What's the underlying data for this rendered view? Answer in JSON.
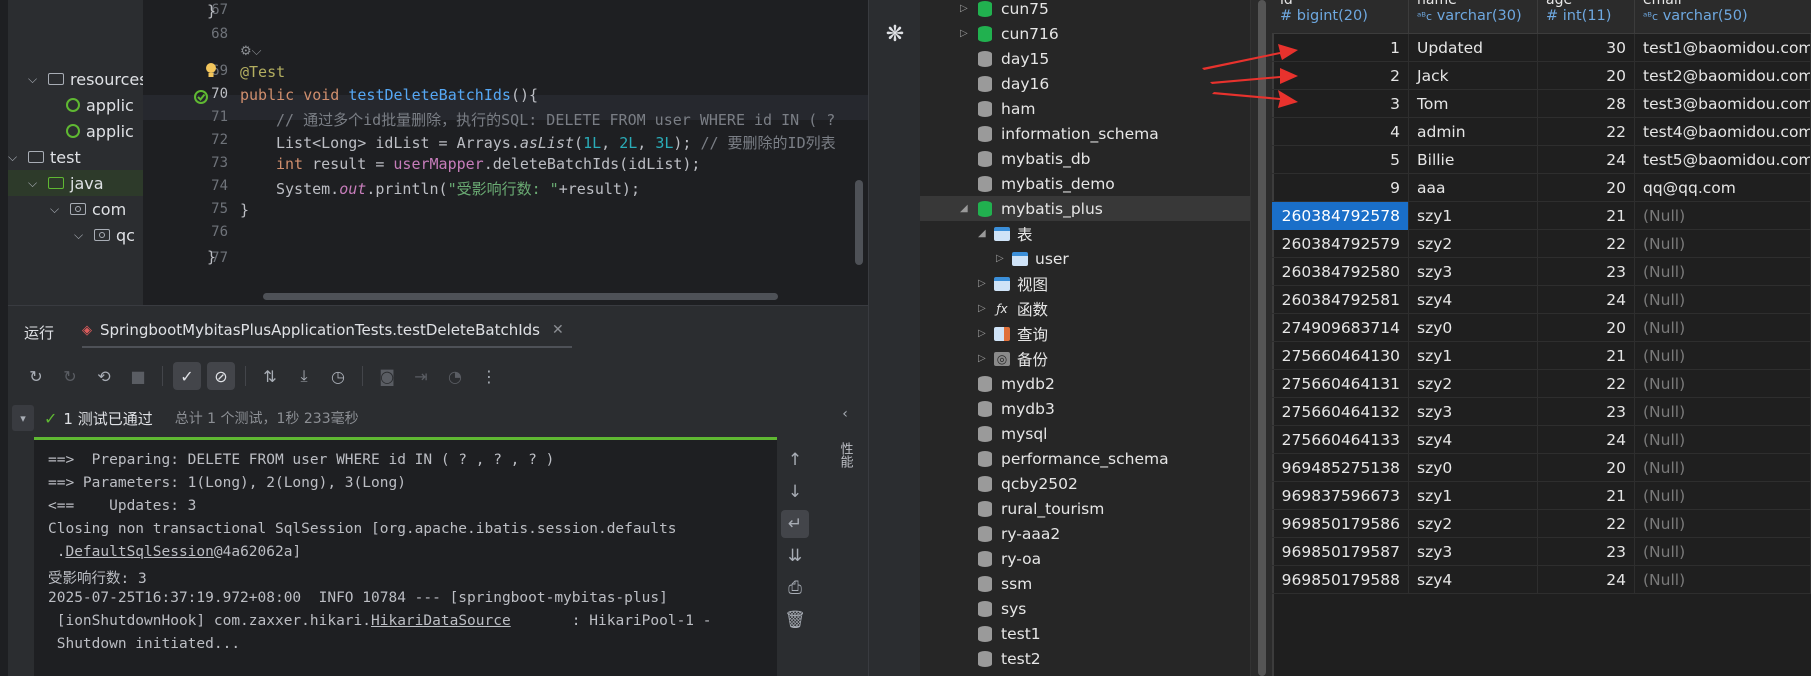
{
  "project_tree": {
    "items": [
      {
        "label": "resources"
      },
      {
        "label": "applic"
      },
      {
        "label": "applic"
      },
      {
        "label": "test"
      },
      {
        "label": "java"
      },
      {
        "label": "com"
      },
      {
        "label": "qc"
      }
    ]
  },
  "editor": {
    "line_numbers": [
      "67",
      "68",
      "69",
      "70",
      "71",
      "72",
      "73",
      "74",
      "75",
      "76",
      "77"
    ],
    "lines": {
      "l67": "}",
      "l69_annotation": "@Test",
      "l70_kw1": "public",
      "l70_kw2": "void",
      "l70_fn": "testDeleteBatchIds",
      "l70_rest": "(){",
      "l71_comment": "// 通过多个id批量删除，执行的SQL: DELETE FROM user WHERE id IN ( ?",
      "l72_a": "List<Long> idList = Arrays.",
      "l72_fn": "asList",
      "l72_b": "(",
      "l72_n1": "1L",
      "l72_c": ", ",
      "l72_n2": "2L",
      "l72_d": ", ",
      "l72_n3": "3L",
      "l72_e": "); ",
      "l72_comment": "// 要删除的ID列表",
      "l73_kw": "int",
      "l73_a": " result = ",
      "l73_fld": "userMapper",
      "l73_b": ".deleteBatchIds(idList);",
      "l74_a": "System.",
      "l74_out": "out",
      "l74_b": ".println(",
      "l74_str": "\"受影响行数: \"",
      "l74_c": "+result);",
      "l75": "}",
      "l77": "}"
    }
  },
  "run_panel": {
    "title": "运行",
    "tab_label": "SpringbootMybitasPlusApplicationTests.testDeleteBatchIds",
    "status_text": "1 测试已通过",
    "status_detail": "总计 1 个测试，1秒 233毫秒",
    "console_lines": {
      "c1": "==>  Preparing: DELETE FROM user WHERE id IN ( ? , ? , ? )",
      "c2": "==> Parameters: 1(Long), 2(Long), 3(Long)",
      "c3": "<==    Updates: 3",
      "c4": "Closing non transactional SqlSession [org.apache.ibatis.session.defaults",
      "c5a": " .",
      "c5b": "DefaultSqlSession",
      "c5c": "@4a62062a]",
      "c6": "受影响行数: 3",
      "c7": "2025-07-25T16:37:19.972+08:00  INFO 10784 --- [springboot-mybitas-plus]",
      "c8a": " [ionShutdownHook] com.zaxxer.hikari.",
      "c8b": "HikariDataSource",
      "c8c": "       : HikariPool-1 -",
      "c9": " Shutdown initiated..."
    },
    "perf_label": "性能"
  },
  "db_tree": {
    "items": [
      {
        "label": "cun75"
      },
      {
        "label": "cun716"
      },
      {
        "label": "day15"
      },
      {
        "label": "day16"
      },
      {
        "label": "ham"
      },
      {
        "label": "information_schema"
      },
      {
        "label": "mybatis_db"
      },
      {
        "label": "mybatis_demo"
      },
      {
        "label": "mybatis_plus"
      },
      {
        "label": "表"
      },
      {
        "label": "user"
      },
      {
        "label": "视图"
      },
      {
        "label": "函数"
      },
      {
        "label": "查询"
      },
      {
        "label": "备份"
      },
      {
        "label": "mydb2"
      },
      {
        "label": "mydb3"
      },
      {
        "label": "mysql"
      },
      {
        "label": "performance_schema"
      },
      {
        "label": "qcby2502"
      },
      {
        "label": "rural_tourism"
      },
      {
        "label": "ry-aaa2"
      },
      {
        "label": "ry-oa"
      },
      {
        "label": "ssm"
      },
      {
        "label": "sys"
      },
      {
        "label": "test1"
      },
      {
        "label": "test2"
      }
    ]
  },
  "grid": {
    "columns": [
      {
        "name": "id",
        "type": "bigint(20)"
      },
      {
        "name": "name",
        "type": "varchar(30)"
      },
      {
        "name": "age",
        "type": "int(11)"
      },
      {
        "name": "email",
        "type": "varchar(50)"
      }
    ],
    "rows": [
      [
        "1",
        "Updated",
        "30",
        "test1@baomidou.com"
      ],
      [
        "2",
        "Jack",
        "20",
        "test2@baomidou.com"
      ],
      [
        "3",
        "Tom",
        "28",
        "test3@baomidou.com"
      ],
      [
        "4",
        "admin",
        "22",
        "test4@baomidou.com"
      ],
      [
        "5",
        "Billie",
        "24",
        "test5@baomidou.com"
      ],
      [
        "9",
        "aaa",
        "20",
        "qq@qq.com"
      ],
      [
        "260384792578",
        "szy1",
        "21",
        "(Null)"
      ],
      [
        "260384792579",
        "szy2",
        "22",
        "(Null)"
      ],
      [
        "260384792580",
        "szy3",
        "23",
        "(Null)"
      ],
      [
        "260384792581",
        "szy4",
        "24",
        "(Null)"
      ],
      [
        "274909683714",
        "szy0",
        "20",
        "(Null)"
      ],
      [
        "275660464130",
        "szy1",
        "21",
        "(Null)"
      ],
      [
        "275660464131",
        "szy2",
        "22",
        "(Null)"
      ],
      [
        "275660464132",
        "szy3",
        "23",
        "(Null)"
      ],
      [
        "275660464133",
        "szy4",
        "24",
        "(Null)"
      ],
      [
        "969485275138",
        "szy0",
        "20",
        "(Null)"
      ],
      [
        "969837596673",
        "szy1",
        "21",
        "(Null)"
      ],
      [
        "969850179586",
        "szy2",
        "22",
        "(Null)"
      ],
      [
        "969850179587",
        "szy3",
        "23",
        "(Null)"
      ],
      [
        "969850179588",
        "szy4",
        "24",
        "(Null)"
      ]
    ]
  },
  "colors": {
    "accent_blue": "#1a6fc9",
    "pass_green": "#5fb832",
    "db_green": "#21b14f",
    "arrow_red": "#e8322d"
  }
}
